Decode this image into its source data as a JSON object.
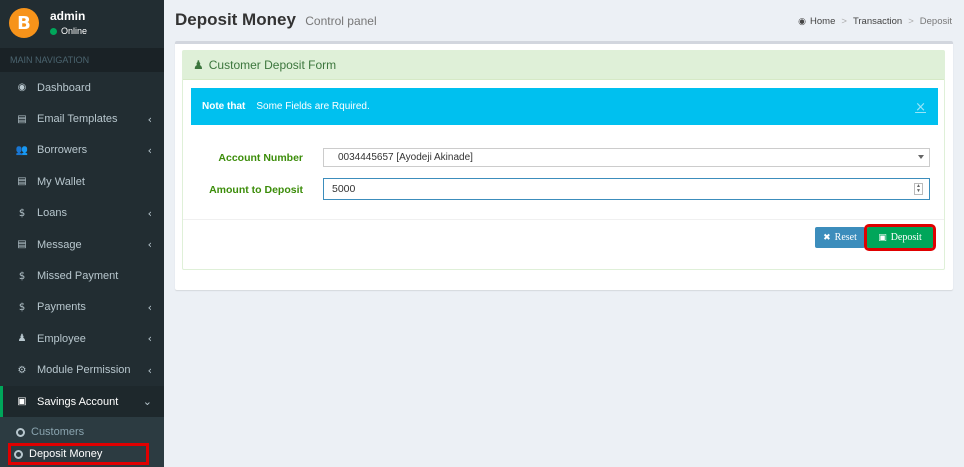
{
  "user": {
    "name": "admin",
    "status": "Online",
    "avatar_glyph": "B"
  },
  "sidebar": {
    "header": "MAIN NAVIGATION",
    "items": [
      {
        "icon": "dashboard-icon",
        "glyph": "◉",
        "label": "Dashboard",
        "chevron": false
      },
      {
        "icon": "book-icon",
        "glyph": "▤",
        "label": "Email Templates",
        "chevron": true
      },
      {
        "icon": "users-icon",
        "glyph": "👥",
        "label": "Borrowers",
        "chevron": true
      },
      {
        "icon": "book-icon",
        "glyph": "▤",
        "label": "My Wallet",
        "chevron": false
      },
      {
        "icon": "dollar-icon",
        "glyph": "$",
        "label": "Loans",
        "chevron": true
      },
      {
        "icon": "book-icon",
        "glyph": "▤",
        "label": "Message",
        "chevron": true
      },
      {
        "icon": "dollar-icon",
        "glyph": "$",
        "label": "Missed Payment",
        "chevron": false
      },
      {
        "icon": "dollar-icon",
        "glyph": "$",
        "label": "Payments",
        "chevron": true
      },
      {
        "icon": "user-icon",
        "glyph": "♟",
        "label": "Employee",
        "chevron": true
      },
      {
        "icon": "cogs-icon",
        "glyph": "⚙",
        "label": "Module Permission",
        "chevron": true
      },
      {
        "icon": "money-icon",
        "glyph": "▣",
        "label": "Savings Account",
        "chevron": "down"
      }
    ],
    "chevron_left": "‹",
    "chevron_down": "⌄",
    "subitems": [
      {
        "label": "Customers"
      },
      {
        "label": "Deposit Money"
      }
    ]
  },
  "header": {
    "title": "Deposit Money",
    "subtitle": "Control panel"
  },
  "breadcrumb": {
    "home": "Home",
    "transaction": "Transaction",
    "current": "Deposit",
    "separator": ">"
  },
  "panel": {
    "title": "Customer Deposit Form",
    "alert": {
      "strong": "Note that",
      "text": "Some Fields are Rquired.",
      "close": "×"
    }
  },
  "form": {
    "account_label": "Account Number",
    "account_value": "0034445657  [Ayodeji Akinade]",
    "amount_label": "Amount to Deposit",
    "amount_value": "5000"
  },
  "buttons": {
    "reset": "Reset",
    "deposit": "Deposit"
  },
  "colors": {
    "sidebar": "#222d32",
    "accent_green": "#00a65a",
    "info": "#00c0ef",
    "primary": "#3c8dbc",
    "highlight": "#e00000"
  }
}
